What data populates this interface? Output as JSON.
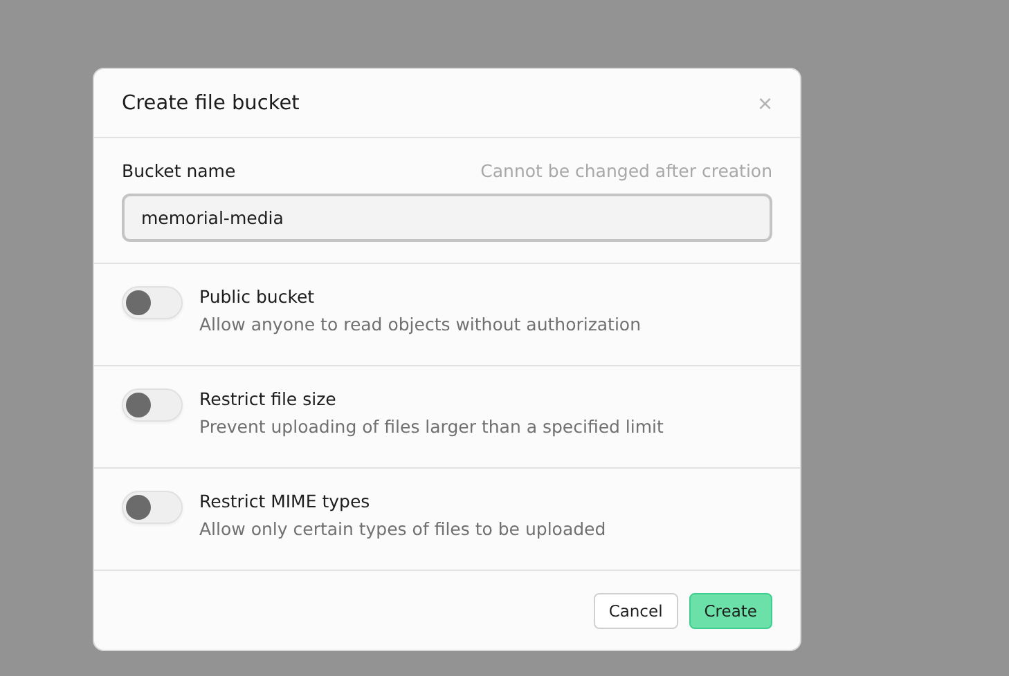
{
  "dialog": {
    "title": "Create file bucket",
    "close_label": "×"
  },
  "field": {
    "label": "Bucket name",
    "hint": "Cannot be changed after creation",
    "value": "memorial-media"
  },
  "options": [
    {
      "title": "Public bucket",
      "description": "Allow anyone to read objects without authorization",
      "on": false
    },
    {
      "title": "Restrict file size",
      "description": "Prevent uploading of files larger than a specified limit",
      "on": false
    },
    {
      "title": "Restrict MIME types",
      "description": "Allow only certain types of files to be uploaded",
      "on": false
    }
  ],
  "buttons": [
    {
      "label": "Cancel",
      "kind": "secondary"
    },
    {
      "label": "Create",
      "kind": "primary"
    }
  ]
}
